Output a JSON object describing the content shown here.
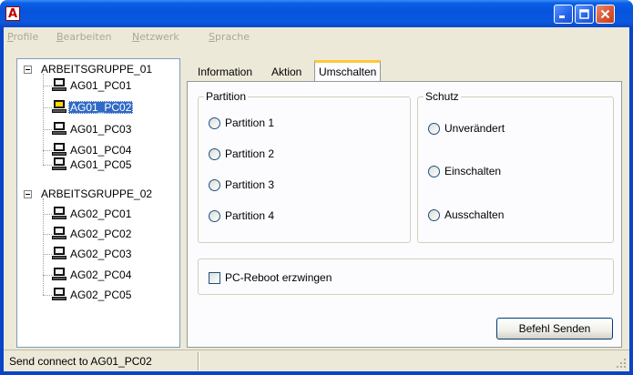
{
  "window": {
    "app_icon_letter": "A"
  },
  "menu": [
    {
      "before": "",
      "underlined": "P",
      "after": "rofile"
    },
    {
      "before": "",
      "underlined": "B",
      "after": "earbeiten"
    },
    {
      "before": "",
      "underlined": "N",
      "after": "etzwerk"
    },
    {
      "before": "",
      "underlined": "S",
      "after": "prache"
    }
  ],
  "tree": {
    "groups": [
      {
        "label": "ARBEITSGRUPPE_01",
        "children": [
          "AG01_PC01",
          "AG01_PC02",
          "AG01_PC03",
          "AG01_PC04",
          "AG01_PC05"
        ]
      },
      {
        "label": "ARBEITSGRUPPE_02",
        "children": [
          "AG02_PC01",
          "AG02_PC02",
          "AG02_PC03",
          "AG02_PC04",
          "AG02_PC05"
        ]
      }
    ],
    "selected": "AG01_PC02"
  },
  "tabs": [
    {
      "label": "Information",
      "active": false
    },
    {
      "label": "Aktion",
      "active": false
    },
    {
      "label": "Umschalten",
      "active": true
    }
  ],
  "partition": {
    "title": "Partition",
    "options": [
      "Partition 1",
      "Partition 2",
      "Partition 3",
      "Partition 4"
    ]
  },
  "schutz": {
    "title": "Schutz",
    "options": [
      "Unverändert",
      "Einschalten",
      "Ausschalten"
    ]
  },
  "reboot": {
    "label": "PC-Reboot erzwingen",
    "checked": false
  },
  "send_button": {
    "label": "Befehl Senden"
  },
  "status": {
    "text": "Send connect to AG01_PC02"
  }
}
